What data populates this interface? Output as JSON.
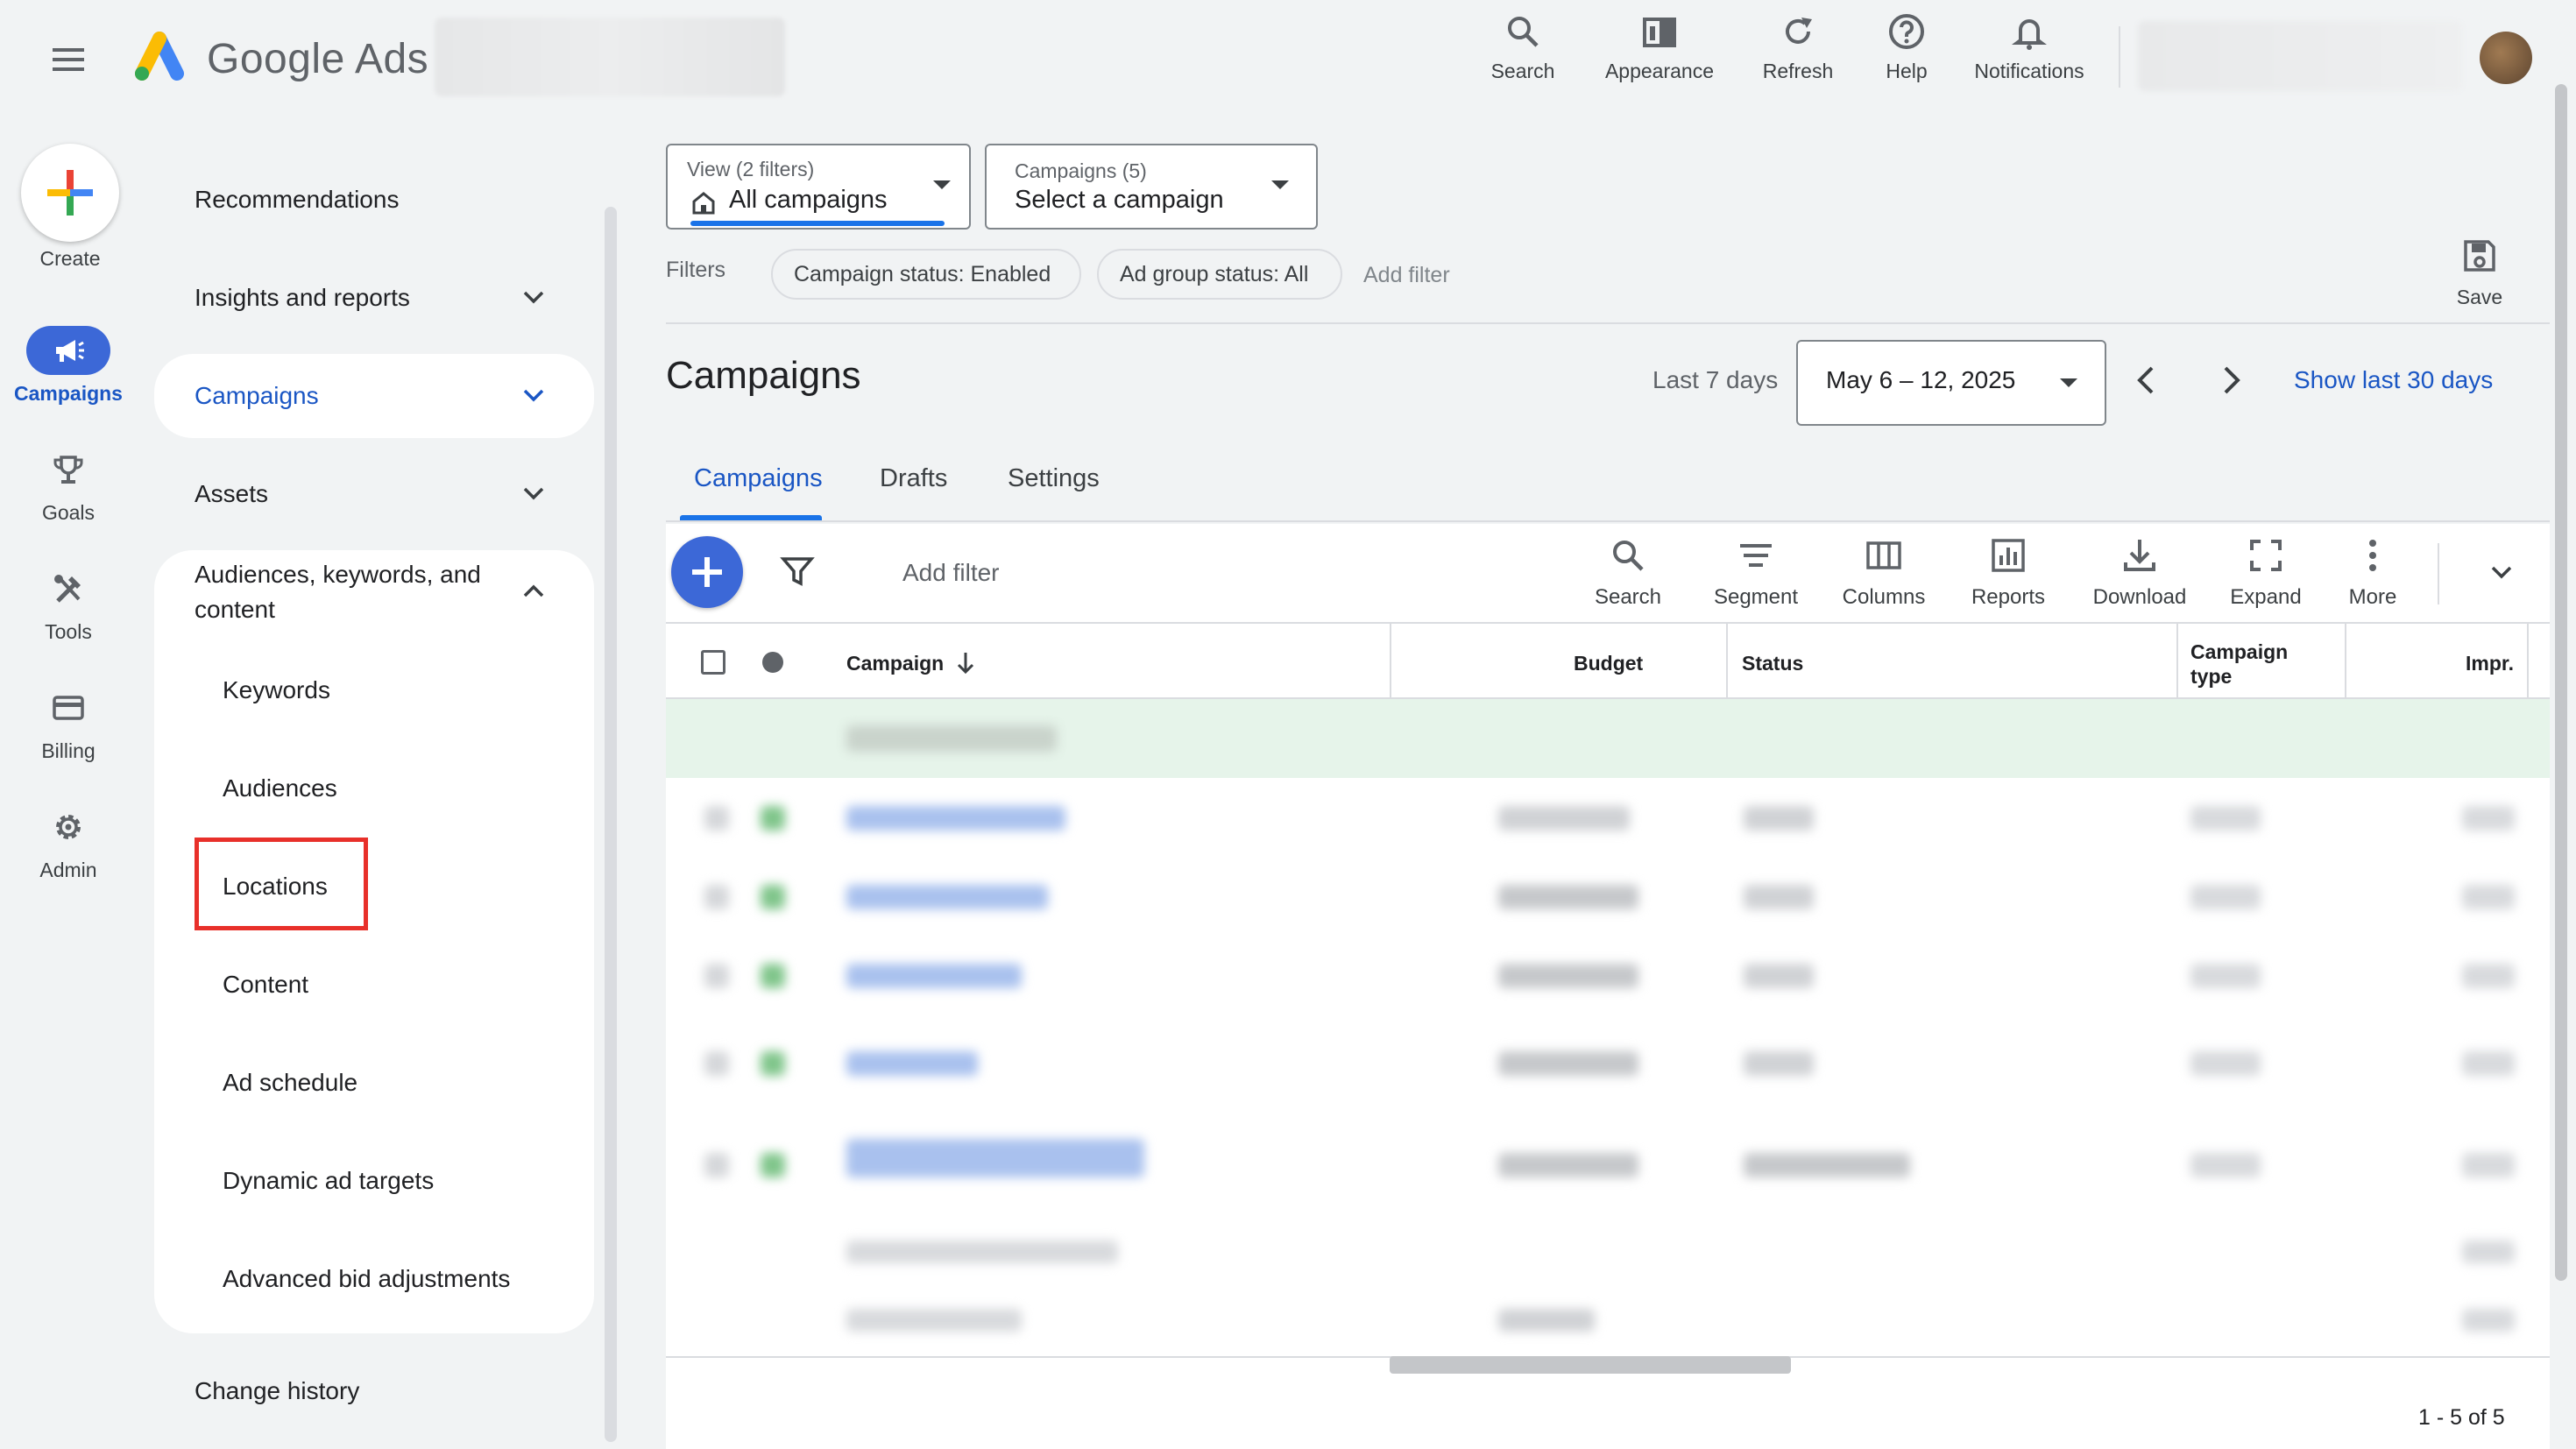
{
  "app": {
    "brand": "Google Ads"
  },
  "topbar": {
    "buttons": [
      {
        "label": "Search",
        "icon": "search-icon"
      },
      {
        "label": "Appearance",
        "icon": "appearance-icon"
      },
      {
        "label": "Refresh",
        "icon": "refresh-icon"
      },
      {
        "label": "Help",
        "icon": "help-icon"
      },
      {
        "label": "Notifications",
        "icon": "bell-icon"
      }
    ]
  },
  "rail": {
    "create": "Create",
    "items": [
      {
        "label": "Campaigns",
        "icon": "megaphone-icon",
        "active": true
      },
      {
        "label": "Goals",
        "icon": "trophy-icon"
      },
      {
        "label": "Tools",
        "icon": "tools-icon"
      },
      {
        "label": "Billing",
        "icon": "billing-card-icon"
      },
      {
        "label": "Admin",
        "icon": "gear-icon"
      }
    ]
  },
  "nav": {
    "recommendations": "Recommendations",
    "insights": "Insights and reports",
    "campaigns": "Campaigns",
    "assets": "Assets",
    "audiences_line1": "Audiences, keywords, and",
    "audiences_line2": "content",
    "sub": [
      "Keywords",
      "Audiences",
      "Locations",
      "Content",
      "Ad schedule",
      "Dynamic ad targets",
      "Advanced bid adjustments"
    ],
    "change_history": "Change history"
  },
  "filters_bar": {
    "view_small": "View (2 filters)",
    "view_big": "All campaigns",
    "campaigns_small": "Campaigns (5)",
    "campaigns_big": "Select a campaign",
    "filters_label": "Filters",
    "chips": [
      "Campaign status: Enabled",
      "Ad group status: All"
    ],
    "add_filter": "Add filter",
    "save": "Save"
  },
  "page": {
    "title": "Campaigns",
    "date_label": "Last 7 days",
    "date_range": "May 6 – 12, 2025",
    "show_last": "Show last 30 days"
  },
  "tabs": [
    "Campaigns",
    "Drafts",
    "Settings"
  ],
  "toolbar": {
    "add_filter": "Add filter",
    "tools": [
      {
        "label": "Search",
        "icon": "search-icon"
      },
      {
        "label": "Segment",
        "icon": "segment-icon"
      },
      {
        "label": "Columns",
        "icon": "columns-icon"
      },
      {
        "label": "Reports",
        "icon": "reports-icon"
      },
      {
        "label": "Download",
        "icon": "download-icon"
      },
      {
        "label": "Expand",
        "icon": "expand-icon"
      },
      {
        "label": "More",
        "icon": "more-vert-icon"
      }
    ]
  },
  "table": {
    "headers": {
      "campaign": "Campaign",
      "budget": "Budget",
      "status": "Status",
      "type_line1": "Campaign",
      "type_line2": "type",
      "impr": "Impr."
    },
    "pagination": "1 - 5 of 5"
  },
  "colors": {
    "accent": "#1a73e8",
    "highlight_box": "#e8302a",
    "rail_active": "#3c68d7"
  }
}
